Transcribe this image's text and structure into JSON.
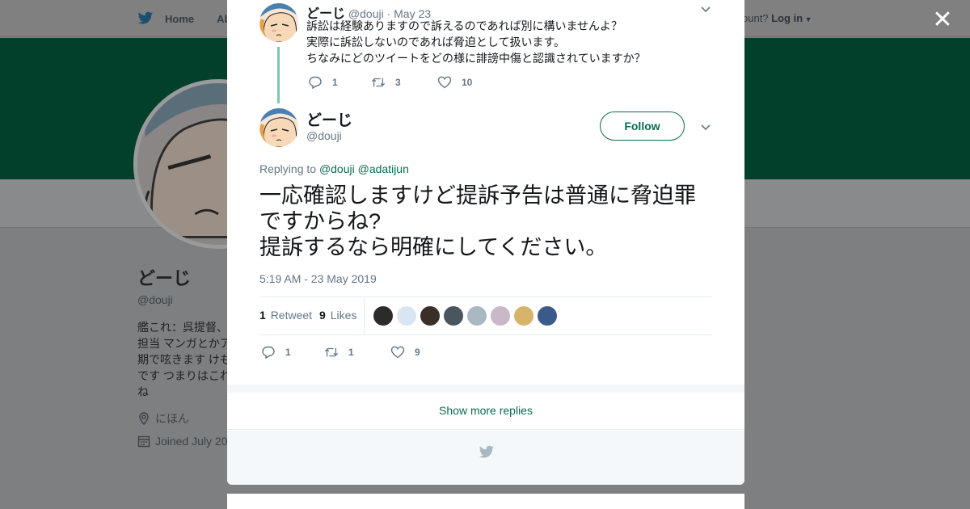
{
  "topbar": {
    "home_label": "Home",
    "about_label": "Abo",
    "account_prompt": "ccount?",
    "login_label": "Log in"
  },
  "profile": {
    "name": "どーじ",
    "handle": "@douji",
    "bio": "艦これ：呉提督、\n担当 マンガとかア\n期で呟きます けも\nです つまりはこれ\nね",
    "location": "にほん",
    "joined": "Joined July 20"
  },
  "parent_tweet": {
    "name": "どーじ",
    "handle": "@douji",
    "date": "· May 23",
    "text": "訴訟は経験ありますので訴えるのであれば別に構いませんよ？\n実際に訴訟しないのであれば脅迫として扱います。\nちなみにどのツイートをどの様に誹謗中傷と認識されていますか？",
    "replies": "1",
    "retweets": "3",
    "likes": "10"
  },
  "main_tweet": {
    "name": "どーじ",
    "handle": "@douji",
    "follow_label": "Follow",
    "replying_prefix": "Replying to",
    "replying_to_1": "@douji",
    "replying_to_2": "@adatijun",
    "text": "一応確認しますけど提訴予告は普通に脅迫罪\nですからね?\n提訴するなら明確にしてください。",
    "timestamp": "5:19 AM - 23 May 2019",
    "retweet_count": "1",
    "retweet_label": "Retweet",
    "like_count": "9",
    "like_label": "Likes",
    "replies": "1",
    "retweets": "1",
    "likes": "9"
  },
  "likers": [
    "#2b2b2b",
    "#d9e6f2",
    "#3a2f28",
    "#4a5560",
    "#aab8c2",
    "#c9b8c8",
    "#d8b46a",
    "#3b5a8a"
  ],
  "show_more_label": "Show more replies",
  "colors": {
    "brand": "#0b6b4d",
    "banner": "#03402c",
    "thread": "#7fc7b0"
  },
  "icons": [
    "twitter-bird-icon",
    "close-icon",
    "chevron-down-icon",
    "reply-icon",
    "retweet-icon",
    "heart-icon",
    "location-icon",
    "calendar-icon"
  ]
}
